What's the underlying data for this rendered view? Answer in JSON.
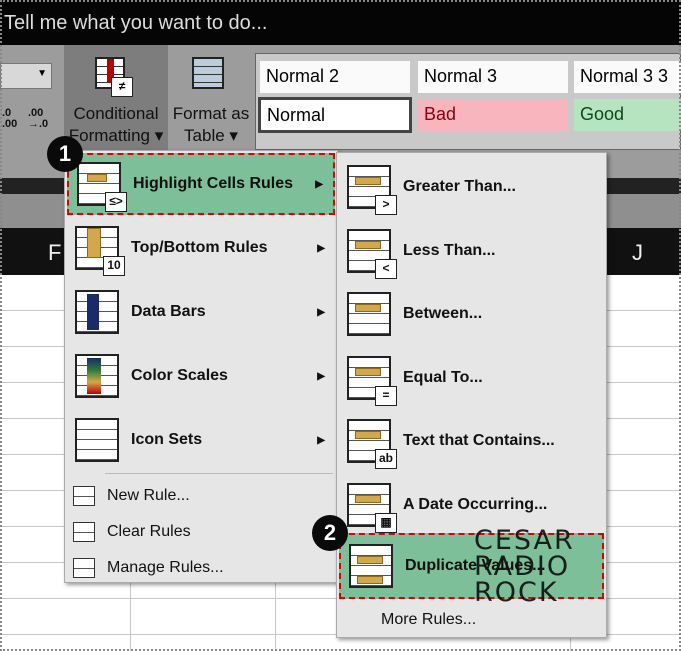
{
  "search": {
    "placeholder": "Tell me what you want to do..."
  },
  "ribbon": {
    "decimal_increase": ".0\n.00",
    "decimal_decrease": ".00\n→.0",
    "conditional_formatting": {
      "line1": "Conditional",
      "line2": "Formatting ▾"
    },
    "format_as_table": {
      "line1": "Format as",
      "line2": "Table ▾"
    },
    "styles": [
      {
        "label": "Normal 2",
        "color": "#fafafa"
      },
      {
        "label": "Normal 3",
        "color": "#fafafa"
      },
      {
        "label": "Normal 3 3",
        "color": "#fafafa"
      },
      {
        "label": "Normal",
        "color": "#ffffff"
      },
      {
        "label": "Bad",
        "color": "#f8b5be"
      },
      {
        "label": "Good",
        "color": "#b6e4c0"
      }
    ]
  },
  "columns": [
    "F",
    "J"
  ],
  "menu": {
    "items": [
      {
        "label": "Highlight Cells Rules",
        "icon": "highlight-cells-icon",
        "submenu": true,
        "highlighted": true
      },
      {
        "label": "Top/Bottom Rules",
        "icon": "top-bottom-icon",
        "submenu": true
      },
      {
        "label": "Data Bars",
        "icon": "data-bars-icon",
        "submenu": true
      },
      {
        "label": "Color Scales",
        "icon": "color-scales-icon",
        "submenu": true
      },
      {
        "label": "Icon Sets",
        "icon": "icon-sets-icon",
        "submenu": true
      }
    ],
    "actions": [
      {
        "label": "New Rule...",
        "icon": "new-rule-icon"
      },
      {
        "label": "Clear Rules",
        "icon": "clear-rules-icon"
      },
      {
        "label": "Manage Rules...",
        "icon": "manage-rules-icon"
      }
    ]
  },
  "submenu": {
    "items": [
      {
        "label": "Greater Than...",
        "tag": ">"
      },
      {
        "label": "Less Than...",
        "tag": "<"
      },
      {
        "label": "Between...",
        "tag": ""
      },
      {
        "label": "Equal To...",
        "tag": "="
      },
      {
        "label": "Text that Contains...",
        "tag": "ab"
      },
      {
        "label": "A Date Occurring...",
        "tag": "▦"
      },
      {
        "label": "Duplicate Values...",
        "tag": "",
        "highlighted": true
      }
    ],
    "more": "More Rules..."
  },
  "badges": [
    "1",
    "2"
  ],
  "watermark": "CESAR RADIO ROCK",
  "colors": {
    "highlight": "#7dbf98",
    "callout_border": "#e00000",
    "menu_bg": "#e6e6e6"
  }
}
